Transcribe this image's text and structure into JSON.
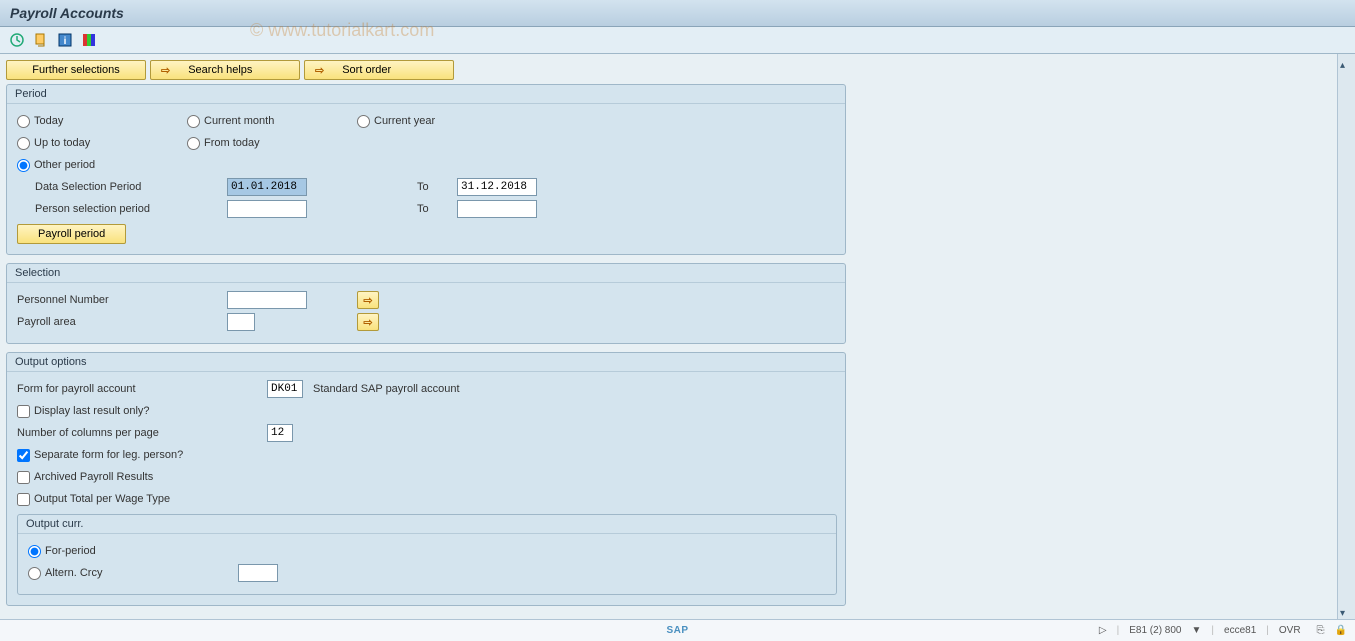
{
  "title": "Payroll Accounts",
  "watermark": "© www.tutorialkart.com",
  "toolbar_icons": {
    "execute": "execute-icon",
    "variant": "variant-icon",
    "info": "info-icon",
    "color": "color-icon"
  },
  "top_buttons": {
    "further_selections": "Further selections",
    "search_helps": "Search helps",
    "sort_order": "Sort order"
  },
  "period": {
    "legend": "Period",
    "today": "Today",
    "current_month": "Current month",
    "current_year": "Current year",
    "up_to_today": "Up to today",
    "from_today": "From today",
    "other_period": "Other period",
    "data_selection_period": "Data Selection Period",
    "person_selection_period": "Person selection period",
    "to": "To",
    "from_date": "01.01.2018",
    "to_date": "31.12.2018",
    "person_from": "",
    "person_to": "",
    "payroll_period_btn": "Payroll period"
  },
  "selection": {
    "legend": "Selection",
    "personnel_number": "Personnel Number",
    "payroll_area": "Payroll area",
    "personnel_value": "",
    "payroll_value": ""
  },
  "output": {
    "legend": "Output options",
    "form_label": "Form for payroll account",
    "form_value": "DK01",
    "form_desc": "Standard SAP payroll account",
    "display_last": "Display last result only?",
    "num_cols_label": "Number of columns per page",
    "num_cols_value": "12",
    "separate_form": "Separate form for leg. person?",
    "archived": "Archived Payroll Results",
    "output_total": "Output Total per Wage Type",
    "output_curr": {
      "legend": "Output curr.",
      "for_period": "For-period",
      "altern": "Altern. Crcy",
      "altern_value": ""
    }
  },
  "status": {
    "triangle": "▷",
    "system": "E81 (2) 800",
    "server": "ecce81",
    "mode": "OVR"
  }
}
